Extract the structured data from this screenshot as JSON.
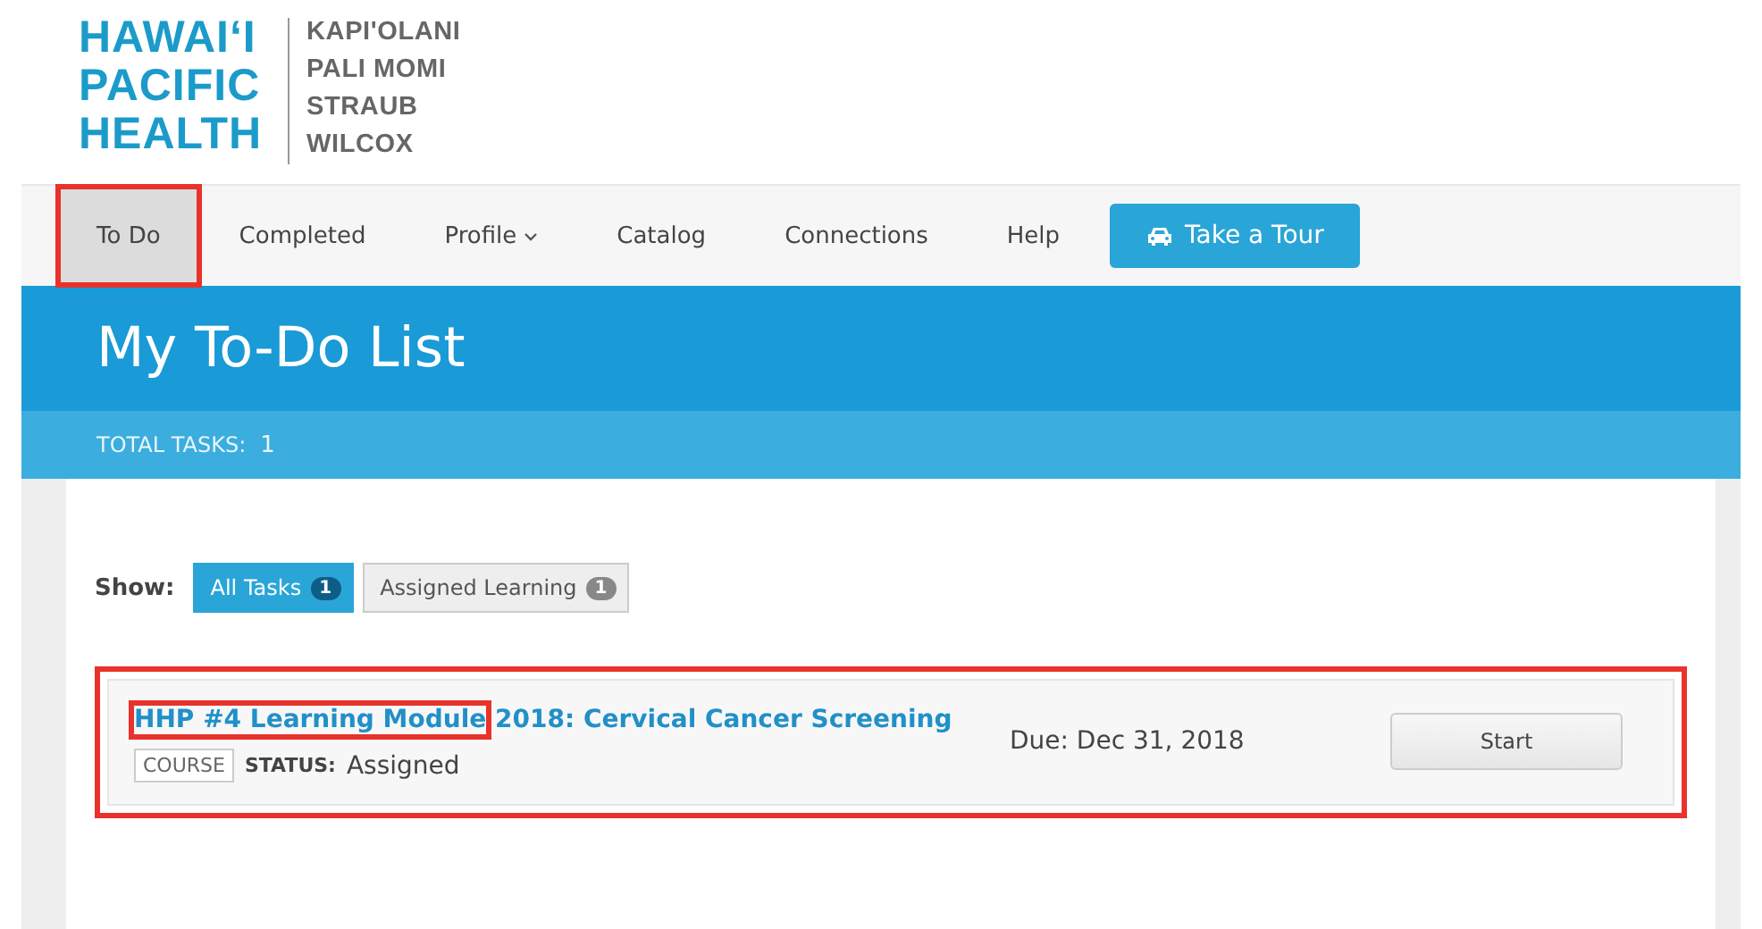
{
  "logo": {
    "name_lines": [
      "HAWAI‘I",
      "PACIFIC",
      "HEALTH"
    ],
    "affiliates": [
      "KAPI'OLANI",
      "PALI MOMI",
      "STRAUB",
      "WILCOX"
    ]
  },
  "nav": {
    "items": [
      {
        "label": "To Do",
        "selected": true,
        "highlighted": true,
        "kind": "link"
      },
      {
        "label": "Completed",
        "selected": false,
        "highlighted": false,
        "kind": "link"
      },
      {
        "label": "Profile",
        "selected": false,
        "highlighted": false,
        "kind": "dropdown"
      },
      {
        "label": "Catalog",
        "selected": false,
        "highlighted": false,
        "kind": "link"
      },
      {
        "label": "Connections",
        "selected": false,
        "highlighted": false,
        "kind": "link"
      },
      {
        "label": "Help",
        "selected": false,
        "highlighted": false,
        "kind": "link"
      }
    ],
    "tour_button": "Take a Tour"
  },
  "page_title": "My To-Do List",
  "total": {
    "label": "TOTAL TASKS:",
    "count": "1"
  },
  "filters": {
    "label": "Show:",
    "items": [
      {
        "label": "All Tasks",
        "count": "1",
        "selected": true
      },
      {
        "label": "Assigned Learning",
        "count": "1",
        "selected": false
      }
    ]
  },
  "tasks": [
    {
      "highlighted": true,
      "title_parts": [
        {
          "text": "HHP #4 Learning Module",
          "highlighted": true
        },
        {
          "text": " 2018: Cervical Cancer Screening",
          "highlighted": false
        }
      ],
      "type": "COURSE",
      "status_label": "STATUS:",
      "status": "Assigned",
      "due": "Due: Dec 31, 2018",
      "action": "Start"
    }
  ]
}
